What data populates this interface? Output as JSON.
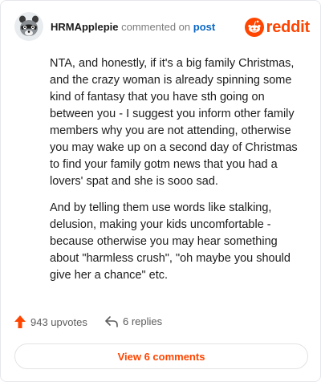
{
  "comment": {
    "username": "HRMApplepie",
    "action_text": "commented on",
    "target_text": "post",
    "paragraphs": [
      "NTA, and honestly, if it's a big family Christmas, and the crazy woman is already spinning some kind of fantasy that you have sth going on between you - I suggest you inform other family members why you are not attending, otherwise you may wake up on a second day of Christmas to find your family gotm news that you had a lovers' spat and she is sooo sad.",
      "And by telling them use words like stalking, delusion, making your kids uncomfortable - because otherwise you may hear something about \"harmless crush\", \"oh maybe you should give her a chance\" etc."
    ]
  },
  "brand": {
    "name": "reddit",
    "icon": "reddit-alien-icon",
    "color": "#ff4500"
  },
  "stats": {
    "upvotes": "943 upvotes",
    "upvote_icon": "upvote-arrow-icon",
    "replies": "6 replies",
    "reply_icon": "reply-arrow-icon"
  },
  "view_button": {
    "label": "View 6 comments"
  },
  "colors": {
    "accent": "#ff4500",
    "link": "#0a66c2",
    "muted": "#7c7c7c"
  },
  "avatar": {
    "icon": "raccoon-avatar-icon"
  }
}
